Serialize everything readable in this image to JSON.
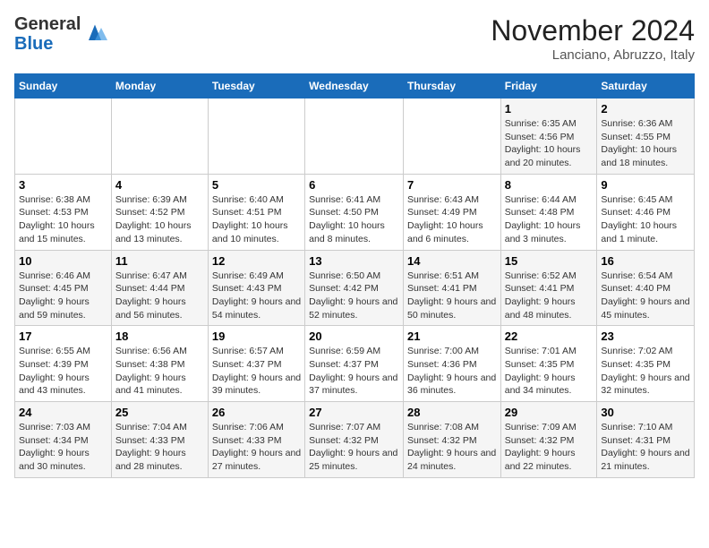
{
  "header": {
    "logo_line1": "General",
    "logo_line2": "Blue",
    "month": "November 2024",
    "location": "Lanciano, Abruzzo, Italy"
  },
  "columns": [
    "Sunday",
    "Monday",
    "Tuesday",
    "Wednesday",
    "Thursday",
    "Friday",
    "Saturday"
  ],
  "weeks": [
    [
      {
        "day": "",
        "info": ""
      },
      {
        "day": "",
        "info": ""
      },
      {
        "day": "",
        "info": ""
      },
      {
        "day": "",
        "info": ""
      },
      {
        "day": "",
        "info": ""
      },
      {
        "day": "1",
        "info": "Sunrise: 6:35 AM\nSunset: 4:56 PM\nDaylight: 10 hours and 20 minutes."
      },
      {
        "day": "2",
        "info": "Sunrise: 6:36 AM\nSunset: 4:55 PM\nDaylight: 10 hours and 18 minutes."
      }
    ],
    [
      {
        "day": "3",
        "info": "Sunrise: 6:38 AM\nSunset: 4:53 PM\nDaylight: 10 hours and 15 minutes."
      },
      {
        "day": "4",
        "info": "Sunrise: 6:39 AM\nSunset: 4:52 PM\nDaylight: 10 hours and 13 minutes."
      },
      {
        "day": "5",
        "info": "Sunrise: 6:40 AM\nSunset: 4:51 PM\nDaylight: 10 hours and 10 minutes."
      },
      {
        "day": "6",
        "info": "Sunrise: 6:41 AM\nSunset: 4:50 PM\nDaylight: 10 hours and 8 minutes."
      },
      {
        "day": "7",
        "info": "Sunrise: 6:43 AM\nSunset: 4:49 PM\nDaylight: 10 hours and 6 minutes."
      },
      {
        "day": "8",
        "info": "Sunrise: 6:44 AM\nSunset: 4:48 PM\nDaylight: 10 hours and 3 minutes."
      },
      {
        "day": "9",
        "info": "Sunrise: 6:45 AM\nSunset: 4:46 PM\nDaylight: 10 hours and 1 minute."
      }
    ],
    [
      {
        "day": "10",
        "info": "Sunrise: 6:46 AM\nSunset: 4:45 PM\nDaylight: 9 hours and 59 minutes."
      },
      {
        "day": "11",
        "info": "Sunrise: 6:47 AM\nSunset: 4:44 PM\nDaylight: 9 hours and 56 minutes."
      },
      {
        "day": "12",
        "info": "Sunrise: 6:49 AM\nSunset: 4:43 PM\nDaylight: 9 hours and 54 minutes."
      },
      {
        "day": "13",
        "info": "Sunrise: 6:50 AM\nSunset: 4:42 PM\nDaylight: 9 hours and 52 minutes."
      },
      {
        "day": "14",
        "info": "Sunrise: 6:51 AM\nSunset: 4:41 PM\nDaylight: 9 hours and 50 minutes."
      },
      {
        "day": "15",
        "info": "Sunrise: 6:52 AM\nSunset: 4:41 PM\nDaylight: 9 hours and 48 minutes."
      },
      {
        "day": "16",
        "info": "Sunrise: 6:54 AM\nSunset: 4:40 PM\nDaylight: 9 hours and 45 minutes."
      }
    ],
    [
      {
        "day": "17",
        "info": "Sunrise: 6:55 AM\nSunset: 4:39 PM\nDaylight: 9 hours and 43 minutes."
      },
      {
        "day": "18",
        "info": "Sunrise: 6:56 AM\nSunset: 4:38 PM\nDaylight: 9 hours and 41 minutes."
      },
      {
        "day": "19",
        "info": "Sunrise: 6:57 AM\nSunset: 4:37 PM\nDaylight: 9 hours and 39 minutes."
      },
      {
        "day": "20",
        "info": "Sunrise: 6:59 AM\nSunset: 4:37 PM\nDaylight: 9 hours and 37 minutes."
      },
      {
        "day": "21",
        "info": "Sunrise: 7:00 AM\nSunset: 4:36 PM\nDaylight: 9 hours and 36 minutes."
      },
      {
        "day": "22",
        "info": "Sunrise: 7:01 AM\nSunset: 4:35 PM\nDaylight: 9 hours and 34 minutes."
      },
      {
        "day": "23",
        "info": "Sunrise: 7:02 AM\nSunset: 4:35 PM\nDaylight: 9 hours and 32 minutes."
      }
    ],
    [
      {
        "day": "24",
        "info": "Sunrise: 7:03 AM\nSunset: 4:34 PM\nDaylight: 9 hours and 30 minutes."
      },
      {
        "day": "25",
        "info": "Sunrise: 7:04 AM\nSunset: 4:33 PM\nDaylight: 9 hours and 28 minutes."
      },
      {
        "day": "26",
        "info": "Sunrise: 7:06 AM\nSunset: 4:33 PM\nDaylight: 9 hours and 27 minutes."
      },
      {
        "day": "27",
        "info": "Sunrise: 7:07 AM\nSunset: 4:32 PM\nDaylight: 9 hours and 25 minutes."
      },
      {
        "day": "28",
        "info": "Sunrise: 7:08 AM\nSunset: 4:32 PM\nDaylight: 9 hours and 24 minutes."
      },
      {
        "day": "29",
        "info": "Sunrise: 7:09 AM\nSunset: 4:32 PM\nDaylight: 9 hours and 22 minutes."
      },
      {
        "day": "30",
        "info": "Sunrise: 7:10 AM\nSunset: 4:31 PM\nDaylight: 9 hours and 21 minutes."
      }
    ]
  ]
}
